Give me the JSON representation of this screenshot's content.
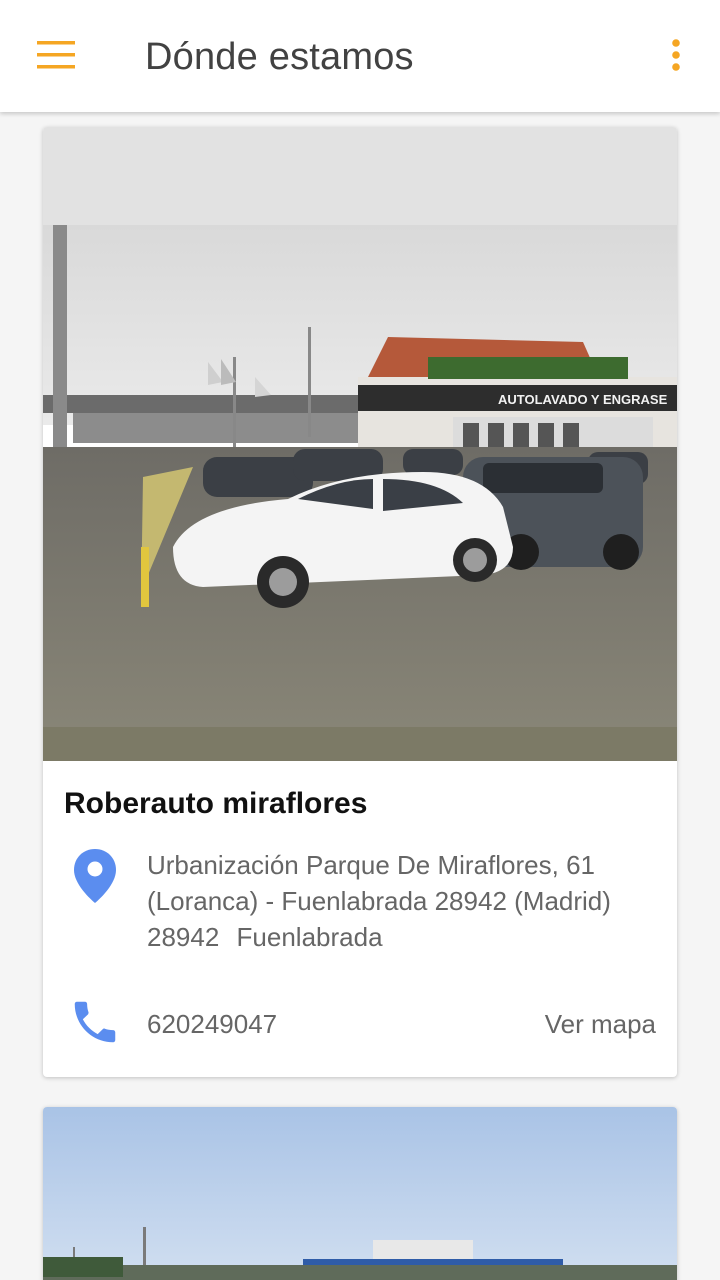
{
  "appbar": {
    "title": "Dónde estamos",
    "menu_icon": "hamburger-menu-icon",
    "overflow_icon": "more-vert-icon",
    "accent_color": "#F5A623"
  },
  "locations": [
    {
      "name": "Roberauto miraflores",
      "address": "Urbanización Parque De Miraflores, 61 (Loranca) - Fuenlabrada 28942 (Madrid)",
      "postal_code": "28942",
      "city": "Fuenlabrada",
      "phone": "620249047",
      "map_link_label": "Ver mapa",
      "icon_color": "#5B8DEF"
    },
    {
      "name": "",
      "address": "",
      "phone": ""
    }
  ]
}
